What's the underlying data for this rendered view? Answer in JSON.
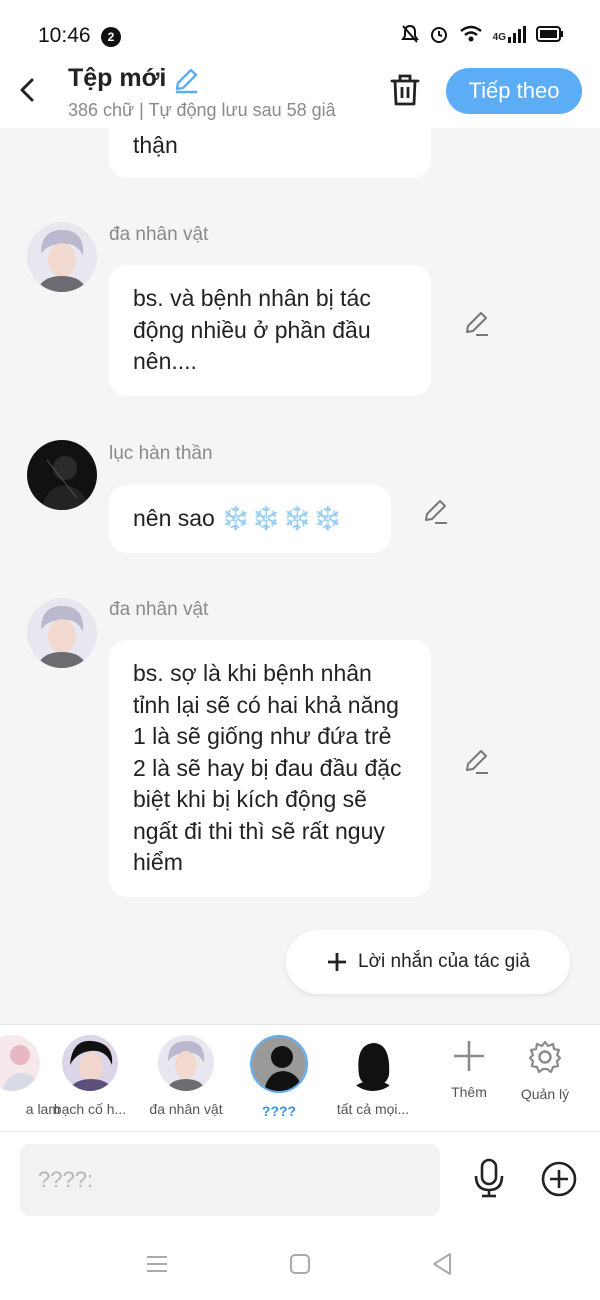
{
  "status_bar": {
    "time": "10:46",
    "notification_count": "2",
    "network": "4G"
  },
  "header": {
    "title": "Tệp mới",
    "subtitle": "386 chữ | Tự động lưu sau 58 giâ",
    "next_label": "Tiếp theo"
  },
  "messages": [
    {
      "speaker": "",
      "text": "thận"
    },
    {
      "speaker": "đa nhân vật",
      "text": "bs.   và bệnh nhân bị tác động nhiều ở phần đầu nên...."
    },
    {
      "speaker": "lục hàn thần",
      "text": "nên sao",
      "emoji": "❄️❄️❄️❄️"
    },
    {
      "speaker": "đa nhân vật",
      "text": "bs.   sợ là khi bệnh nhân tỉnh lại sẽ có hai khả năng 1 là sẽ giống như đứa trẻ 2 là sẽ hay bị đau đầu đặc biệt khi bị kích động sẽ ngất đi thi thì sẽ rất nguy hiểm"
    }
  ],
  "author_note_label": "Lời nhắn của tác giả",
  "characters": [
    {
      "name": "a lam"
    },
    {
      "name": "bạch cố h..."
    },
    {
      "name": "đa nhân vật"
    },
    {
      "name": "????",
      "selected": true
    },
    {
      "name": "tất cả mọi..."
    }
  ],
  "tools": {
    "add_label": "Thêm",
    "manage_label": "Quản lý"
  },
  "input": {
    "placeholder": "????:"
  },
  "colors": {
    "accent": "#5cadf5",
    "background": "#f5f5f5",
    "bubble": "#ffffff"
  },
  "icons": {
    "back": "back-arrow-icon",
    "edit": "pencil-icon",
    "trash": "trash-icon",
    "mic": "microphone-icon",
    "plus": "plus-circle-icon",
    "gear": "gear-icon"
  }
}
